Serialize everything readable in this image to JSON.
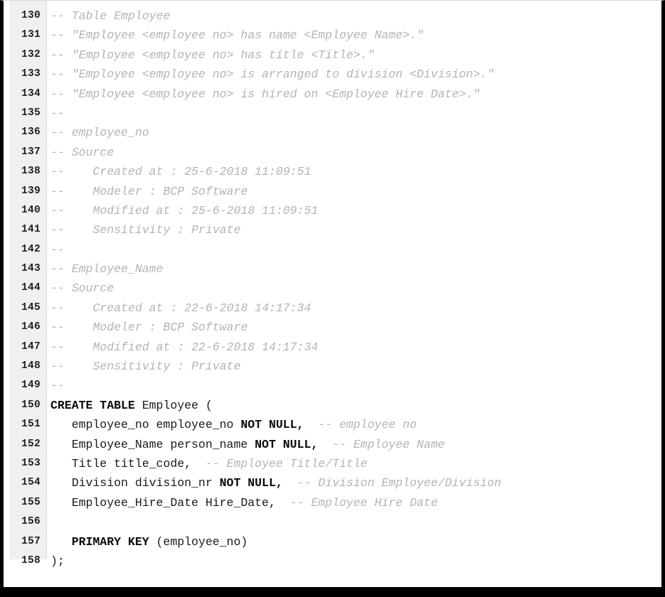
{
  "editor": {
    "type": "sql-code-viewer",
    "language": "SQL",
    "gutter_bg": "#f0f0f0",
    "background": "#ffffff",
    "comment_color": "#b4b4b4",
    "keyword_color": "#0a0a0a",
    "text_color": "#1a1a1a",
    "frame_color": "#000000",
    "first_line_number": 130,
    "last_line_number": 158
  },
  "lines": [
    {
      "number": "130",
      "tokens": [
        {
          "style": "comment",
          "text": "-- Table Employee"
        }
      ]
    },
    {
      "number": "131",
      "tokens": [
        {
          "style": "comment",
          "text": "-- \"Employee <employee no> has name <Employee Name>.\""
        }
      ]
    },
    {
      "number": "132",
      "tokens": [
        {
          "style": "comment",
          "text": "-- \"Employee <employee no> has title <Title>.\""
        }
      ]
    },
    {
      "number": "133",
      "tokens": [
        {
          "style": "comment",
          "text": "-- \"Employee <employee no> is arranged to division <Division>.\""
        }
      ]
    },
    {
      "number": "134",
      "tokens": [
        {
          "style": "comment",
          "text": "-- \"Employee <employee no> is hired on <Employee Hire Date>.\""
        }
      ]
    },
    {
      "number": "135",
      "tokens": [
        {
          "style": "comment",
          "text": "--"
        }
      ]
    },
    {
      "number": "136",
      "tokens": [
        {
          "style": "comment",
          "text": "-- employee_no"
        }
      ]
    },
    {
      "number": "137",
      "tokens": [
        {
          "style": "comment",
          "text": "-- Source"
        }
      ]
    },
    {
      "number": "138",
      "tokens": [
        {
          "style": "comment",
          "text": "--    Created at : 25-6-2018 11:09:51"
        }
      ]
    },
    {
      "number": "139",
      "tokens": [
        {
          "style": "comment",
          "text": "--    Modeler : BCP Software"
        }
      ]
    },
    {
      "number": "140",
      "tokens": [
        {
          "style": "comment",
          "text": "--    Modified at : 25-6-2018 11:09:51"
        }
      ]
    },
    {
      "number": "141",
      "tokens": [
        {
          "style": "comment",
          "text": "--    Sensitivity : Private"
        }
      ]
    },
    {
      "number": "142",
      "tokens": [
        {
          "style": "comment",
          "text": "--"
        }
      ]
    },
    {
      "number": "143",
      "tokens": [
        {
          "style": "comment",
          "text": "-- Employee_Name"
        }
      ]
    },
    {
      "number": "144",
      "tokens": [
        {
          "style": "comment",
          "text": "-- Source"
        }
      ]
    },
    {
      "number": "145",
      "tokens": [
        {
          "style": "comment",
          "text": "--    Created at : 22-6-2018 14:17:34"
        }
      ]
    },
    {
      "number": "146",
      "tokens": [
        {
          "style": "comment",
          "text": "--    Modeler : BCP Software"
        }
      ]
    },
    {
      "number": "147",
      "tokens": [
        {
          "style": "comment",
          "text": "--    Modified at : 22-6-2018 14:17:34"
        }
      ]
    },
    {
      "number": "148",
      "tokens": [
        {
          "style": "comment",
          "text": "--    Sensitivity : Private"
        }
      ]
    },
    {
      "number": "149",
      "tokens": [
        {
          "style": "comment",
          "text": "--"
        }
      ]
    },
    {
      "number": "150",
      "tokens": [
        {
          "style": "kw",
          "text": "CREATE TABLE"
        },
        {
          "style": "plain",
          "text": " Employee ("
        }
      ]
    },
    {
      "number": "151",
      "tokens": [
        {
          "style": "plain",
          "text": "   employee_no employee_no "
        },
        {
          "style": "kw",
          "text": "NOT NULL,"
        },
        {
          "style": "comment",
          "text": "  -- employee no"
        }
      ]
    },
    {
      "number": "152",
      "tokens": [
        {
          "style": "plain",
          "text": "   Employee_Name person_name "
        },
        {
          "style": "kw",
          "text": "NOT NULL,"
        },
        {
          "style": "comment",
          "text": "  -- Employee Name"
        }
      ]
    },
    {
      "number": "153",
      "tokens": [
        {
          "style": "plain",
          "text": "   Title title_code,"
        },
        {
          "style": "comment",
          "text": "  -- Employee Title/Title"
        }
      ]
    },
    {
      "number": "154",
      "tokens": [
        {
          "style": "plain",
          "text": "   Division division_nr "
        },
        {
          "style": "kw",
          "text": "NOT NULL,"
        },
        {
          "style": "comment",
          "text": "  -- Division Employee/Division"
        }
      ]
    },
    {
      "number": "155",
      "tokens": [
        {
          "style": "plain",
          "text": "   Employee_Hire_Date Hire_Date,"
        },
        {
          "style": "comment",
          "text": "  -- Employee Hire Date"
        }
      ]
    },
    {
      "number": "156",
      "tokens": []
    },
    {
      "number": "157",
      "tokens": [
        {
          "style": "kw",
          "text": "   PRIMARY KEY"
        },
        {
          "style": "plain",
          "text": " (employee_no)"
        }
      ]
    },
    {
      "number": "158",
      "tokens": [
        {
          "style": "plain",
          "text": ");"
        }
      ]
    }
  ]
}
